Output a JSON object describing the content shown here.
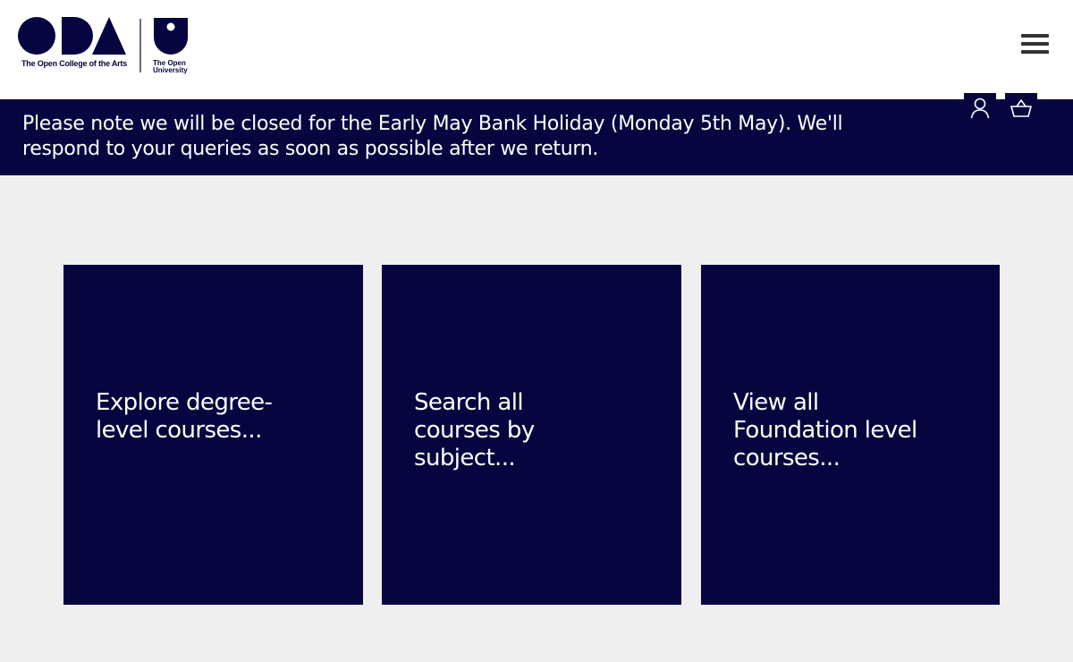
{
  "header": {
    "logo_oca_text": "The Open College of the Arts",
    "logo_ou_line1": "The Open",
    "logo_ou_line2": "University",
    "menu_icon": "hamburger-menu-icon"
  },
  "banner": {
    "text": "Please note we will be closed for the Early May Bank Holiday (Monday 5th May). We'll respond to your queries as soon as possible after we return."
  },
  "actions": {
    "account_icon": "user-icon",
    "basket_icon": "basket-icon"
  },
  "cards": [
    {
      "label": "Explore degree-level courses..."
    },
    {
      "label": "Search all courses by subject..."
    },
    {
      "label": "View all Foundation level courses..."
    }
  ],
  "colors": {
    "brand_navy": "#06053f",
    "page_background": "#efefef",
    "header_background": "#ffffff",
    "menu_icon": "#333333"
  }
}
